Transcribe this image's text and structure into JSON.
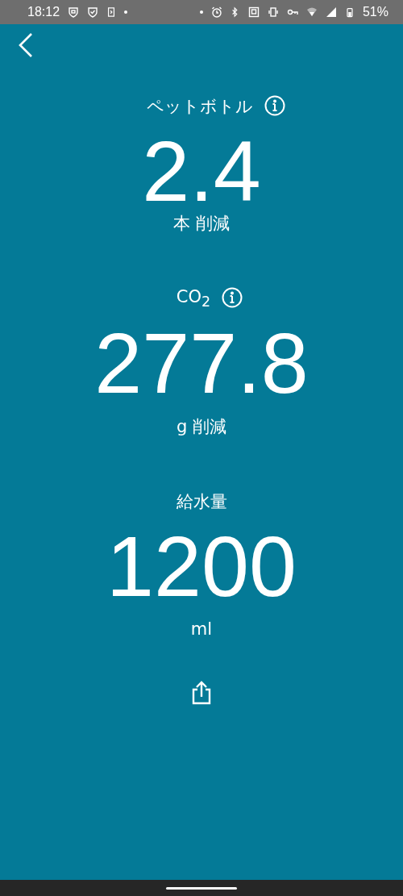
{
  "status_bar": {
    "time": "18:12",
    "battery_text": "51%"
  },
  "stats": [
    {
      "label": "ペットボトル",
      "info": true,
      "value": "2.4",
      "unit": "本 削減"
    },
    {
      "label": "CO$_{2}$",
      "info": true,
      "value": "277.8",
      "unit": "g 削減"
    },
    {
      "label": "給水量",
      "info": false,
      "value": "1200",
      "unit": "ml"
    }
  ]
}
